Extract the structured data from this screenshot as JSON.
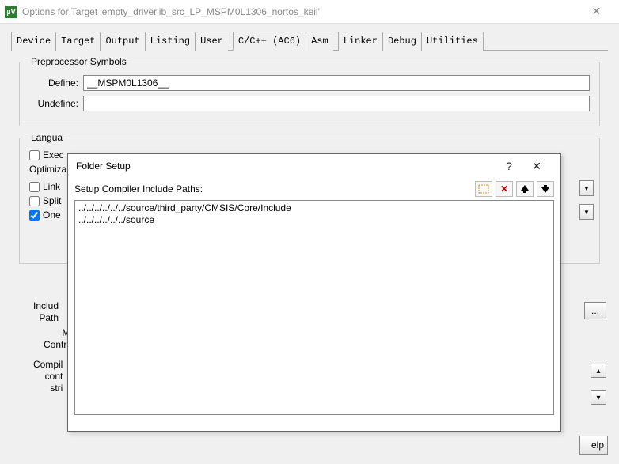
{
  "window": {
    "title": "Options for Target 'empty_driverlib_src_LP_MSPM0L1306_nortos_keil'"
  },
  "tabs": [
    {
      "label": "Device"
    },
    {
      "label": "Target"
    },
    {
      "label": "Output"
    },
    {
      "label": "Listing"
    },
    {
      "label": "User"
    },
    {
      "label": "C/C++ (AC6)"
    },
    {
      "label": "Asm"
    },
    {
      "label": "Linker"
    },
    {
      "label": "Debug"
    },
    {
      "label": "Utilities"
    }
  ],
  "preproc": {
    "legend": "Preprocessor Symbols",
    "define_label": "Define:",
    "define_value": "__MSPM0L1306__",
    "undefine_label": "Undefine:",
    "undefine_value": ""
  },
  "lang": {
    "legend_fragment": "Langua",
    "exec": "Exec",
    "optimiz": "Optimiza",
    "link": "Link",
    "split": "Split",
    "one": "One"
  },
  "right_labels": {
    "include": "Includ",
    "path": "Path",
    "misc": "Mi",
    "control": "Contro",
    "compil": "Compil",
    "cont": "cont",
    "strip": "stri"
  },
  "modal": {
    "title": "Folder Setup",
    "toolbar_label": "Setup Compiler Include Paths:",
    "paths": [
      "../../../../../../source/third_party/CMSIS/Core/Include",
      "../../../../../../source"
    ]
  },
  "help_fragment": "elp"
}
